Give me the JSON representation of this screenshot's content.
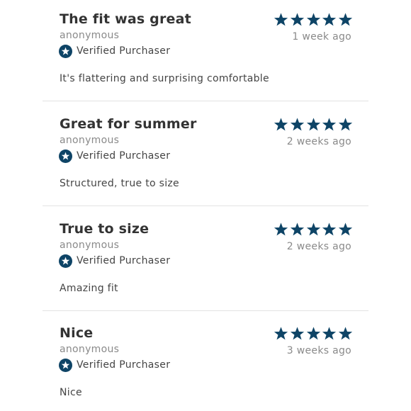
{
  "theme": {
    "star_color": "#0e4466",
    "badge_color": "#0e4466"
  },
  "reviews": [
    {
      "title": "The fit was great",
      "author": "anonymous",
      "verified_label": "Verified Purchaser",
      "date": "1 week ago",
      "body": "It's flattering and surprising comfortable",
      "rating": 5,
      "rating_max": 5
    },
    {
      "title": "Great for summer",
      "author": "anonymous",
      "verified_label": "Verified Purchaser",
      "date": "2 weeks ago",
      "body": "Structured, true to size",
      "rating": 5,
      "rating_max": 5
    },
    {
      "title": "True to size",
      "author": "anonymous",
      "verified_label": "Verified Purchaser",
      "date": "2 weeks ago",
      "body": "Amazing fit",
      "rating": 5,
      "rating_max": 5
    },
    {
      "title": "Nice",
      "author": "anonymous",
      "verified_label": "Verified Purchaser",
      "date": "3 weeks ago",
      "body": "Nice",
      "rating": 5,
      "rating_max": 5
    }
  ]
}
